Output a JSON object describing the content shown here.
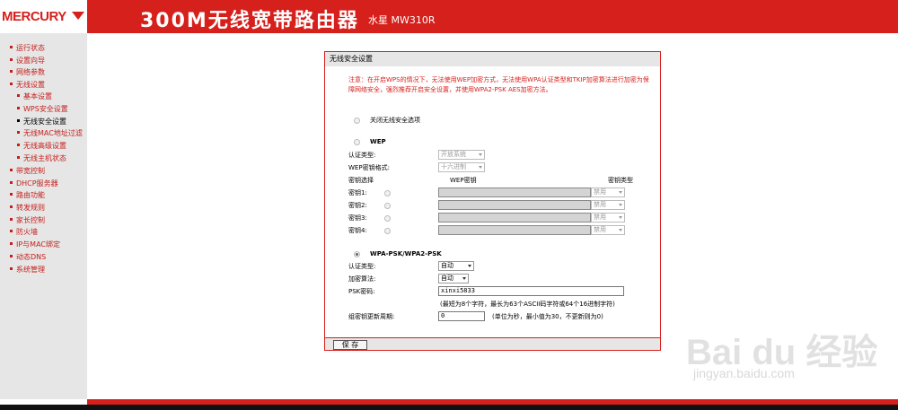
{
  "header": {
    "brand": "MERCURY",
    "product": "300M无线宽带路由器",
    "model": "水星 MW310R"
  },
  "sidebar": {
    "items": [
      {
        "label": "运行状态"
      },
      {
        "label": "设置向导"
      },
      {
        "label": "网络参数"
      },
      {
        "label": "无线设置"
      },
      {
        "label": "基本设置"
      },
      {
        "label": "WPS安全设置"
      },
      {
        "label": "无线安全设置"
      },
      {
        "label": "无线MAC地址过滤"
      },
      {
        "label": "无线高级设置"
      },
      {
        "label": "无线主机状态"
      },
      {
        "label": "带宽控制"
      },
      {
        "label": "DHCP服务器"
      },
      {
        "label": "路由功能"
      },
      {
        "label": "转发规则"
      },
      {
        "label": "家长控制"
      },
      {
        "label": "防火墙"
      },
      {
        "label": "IP与MAC绑定"
      },
      {
        "label": "动态DNS"
      },
      {
        "label": "系统管理"
      }
    ]
  },
  "panel": {
    "title": "无线安全设置",
    "notice": "注意：在开启WPS的情况下，无法使用WEP加密方式，无法使用WPA认证类型和TKIP加密算法进行加密为保障网络安全，强烈推荐开启安全设置，并使用WPA2-PSK AES加密方法。",
    "option_off": "关闭无线安全选项",
    "wep": {
      "label": "WEP",
      "auth_label": "认证类型:",
      "auth_value": "开放系统",
      "format_label": "WEP密钥格式:",
      "format_value": "十六进制",
      "col_select": "密钥选择",
      "col_key": "WEP密钥",
      "col_type": "密钥类型",
      "keys": [
        {
          "label": "密钥1:",
          "type": "禁用"
        },
        {
          "label": "密钥2:",
          "type": "禁用"
        },
        {
          "label": "密钥3:",
          "type": "禁用"
        },
        {
          "label": "密钥4:",
          "type": "禁用"
        }
      ]
    },
    "wpa": {
      "label": "WPA-PSK/WPA2-PSK",
      "auth_label": "认证类型:",
      "auth_value": "自动",
      "cipher_label": "加密算法:",
      "cipher_value": "自动",
      "psk_label": "PSK密码:",
      "psk_value": "xinxi5833",
      "psk_hint": "(最短为8个字符，最长为63个ASCII码字符或64个16进制字符)",
      "rekey_label": "组密钥更新周期:",
      "rekey_value": "0",
      "rekey_hint": "(单位为秒，最小值为30，不更新则为0)"
    },
    "save_label": "保 存"
  },
  "watermark": {
    "text": "Bai du 经验",
    "url": "jingyan.baidu.com"
  },
  "colors": {
    "accent": "#d6201c",
    "sidebar_bg": "#e6e6e6"
  }
}
